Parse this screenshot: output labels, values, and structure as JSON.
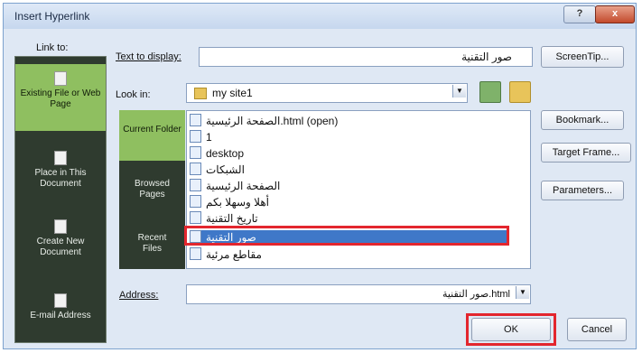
{
  "dialog": {
    "title": "Insert Hyperlink",
    "help_button": "?",
    "close_button": "x"
  },
  "link_to": {
    "label": "Link to:",
    "items": [
      {
        "label": "Existing File or Web Page",
        "icon": "web-page-icon",
        "selected": true
      },
      {
        "label": "Place in This Document",
        "icon": "document-icon",
        "selected": false
      },
      {
        "label": "Create New Document",
        "icon": "new-document-icon",
        "selected": false
      },
      {
        "label": "E-mail Address",
        "icon": "email-icon",
        "selected": false
      }
    ]
  },
  "text_to_display": {
    "label": "Text to display:",
    "value": "صور التقنية"
  },
  "screentip_button": "ScreenTip...",
  "look_in": {
    "label": "Look in:",
    "value": "my site1",
    "icon": "folder-icon"
  },
  "look_in_bar": {
    "items": [
      {
        "label": "Current Folder",
        "selected": true
      },
      {
        "label": "Browsed Pages",
        "selected": false
      },
      {
        "label": "Recent Files",
        "selected": false
      }
    ]
  },
  "files": [
    {
      "name": "الصفحة الرئيسية.html (open)",
      "icon": "html-file-icon"
    },
    {
      "name": "1",
      "icon": "file-icon"
    },
    {
      "name": "desktop",
      "icon": "file-icon"
    },
    {
      "name": "الشبكات",
      "icon": "file-icon"
    },
    {
      "name": "الصفحة الرئيسية",
      "icon": "html-file-icon"
    },
    {
      "name": "أهلا وسهلا بكم",
      "icon": "file-icon"
    },
    {
      "name": "تاريخ التقنية",
      "icon": "html-file-icon"
    },
    {
      "name": "صور التقنية",
      "icon": "file-icon",
      "selected": true
    },
    {
      "name": "مقاطع مرئية",
      "icon": "html-file-icon"
    }
  ],
  "side_buttons": {
    "bookmark": "Bookmark...",
    "target_frame": "Target Frame...",
    "parameters": "Parameters..."
  },
  "address": {
    "label": "Address:",
    "value": "صور التقنية.html"
  },
  "ok_button": "OK",
  "cancel_button": "Cancel",
  "colors": {
    "selected_bar": "#8fbf60",
    "bar_background": "#2f3b2f",
    "highlight": "#e3262e",
    "selection": "#3f78c8"
  }
}
